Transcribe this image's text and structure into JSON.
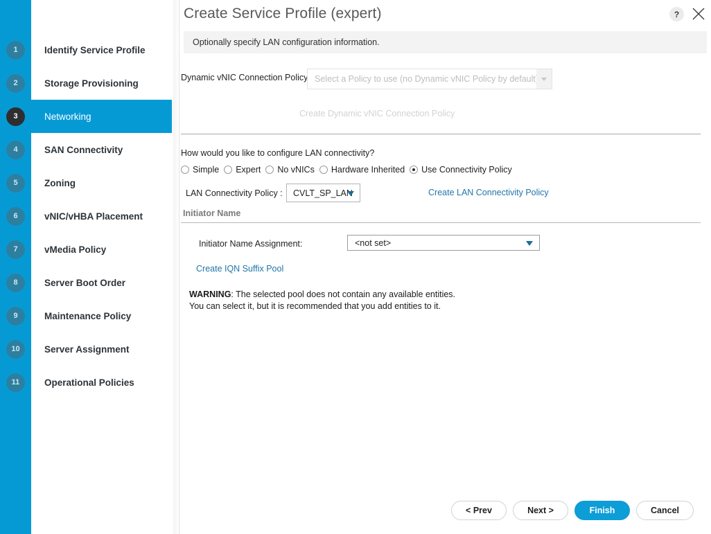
{
  "sidebar": {
    "steps": [
      {
        "number": "1",
        "label": "Identify Service Profile",
        "active": false
      },
      {
        "number": "2",
        "label": "Storage Provisioning",
        "active": false
      },
      {
        "number": "3",
        "label": "Networking",
        "active": true
      },
      {
        "number": "4",
        "label": "SAN Connectivity",
        "active": false
      },
      {
        "number": "5",
        "label": "Zoning",
        "active": false
      },
      {
        "number": "6",
        "label": "vNIC/vHBA Placement",
        "active": false
      },
      {
        "number": "7",
        "label": "vMedia Policy",
        "active": false
      },
      {
        "number": "8",
        "label": "Server Boot Order",
        "active": false
      },
      {
        "number": "9",
        "label": "Maintenance Policy",
        "active": false
      },
      {
        "number": "10",
        "label": "Server Assignment",
        "active": false
      },
      {
        "number": "11",
        "label": "Operational Policies",
        "active": false
      }
    ]
  },
  "header": {
    "title": "Create Service Profile (expert)",
    "help_label": "?",
    "close_label": "close-icon",
    "subtitle": "Optionally specify LAN configuration information."
  },
  "dynamic_vnic": {
    "label": "Dynamic vNIC Connection Policy:",
    "placeholder": "Select a Policy to use (no Dynamic vNIC Policy by default)",
    "value": "",
    "create_link": "Create Dynamic vNIC Connection Policy"
  },
  "lan_connectivity": {
    "question": "How would you like to configure LAN connectivity?",
    "options": [
      {
        "label": "Simple",
        "checked": false
      },
      {
        "label": "Expert",
        "checked": false
      },
      {
        "label": "No vNICs",
        "checked": false
      },
      {
        "label": "Hardware Inherited",
        "checked": false
      },
      {
        "label": "Use Connectivity Policy",
        "checked": true
      }
    ],
    "policy_label": "LAN Connectivity Policy :",
    "policy_value": "CVLT_SP_LAN",
    "create_link": "Create LAN Connectivity Policy"
  },
  "initiator_name": {
    "section_title": "Initiator Name",
    "assignment_label": "Initiator Name Assignment:",
    "assignment_value": "<not set>",
    "create_link": "Create IQN Suffix Pool",
    "warning_prefix": "WARNING",
    "warning_line1": ": The selected pool does not contain any available entities.",
    "warning_line2": "You can select it, but it is recommended that you add entities to it."
  },
  "footer": {
    "prev": "< Prev",
    "next": "Next >",
    "finish": "Finish",
    "cancel": "Cancel"
  },
  "colors": {
    "accent_blue": "#069ad5",
    "finish_blue": "#0d9dd7",
    "link_blue": "#2076a8",
    "step_badge": "#2d7fa0",
    "active_badge": "#2e2e31"
  }
}
